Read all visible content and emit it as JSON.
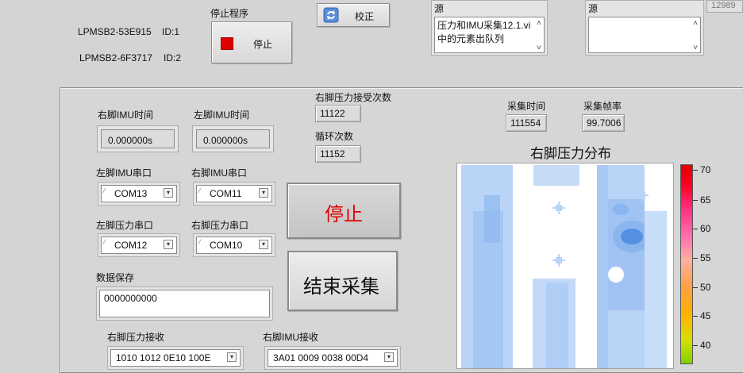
{
  "top": {
    "device1_name": "LPMSB2-53E915",
    "device1_id": "ID:1",
    "device2_name": "LPMSB2-6F3717",
    "device2_id": "ID:2",
    "stop_program_label": "停止程序",
    "stop_button": "停止",
    "calibrate_button": "校正",
    "source1_label": "源",
    "source1_text": "压力和IMU采集12.1.vi中的元素出队列",
    "source2_label": "源",
    "source2_text": "",
    "corner_value": "12989"
  },
  "panel": {
    "right_imu_time_label": "右脚IMU时间",
    "right_imu_time": "0.000000s",
    "left_imu_time_label": "左脚IMU时间",
    "left_imu_time": "0.000000s",
    "right_pressure_count_label": "右脚压力接受次数",
    "right_pressure_count": "11122",
    "loop_count_label": "循环次数",
    "loop_count": "11152",
    "collect_time_label": "采集时间",
    "collect_time": "111554",
    "collect_fps_label": "采集帧率",
    "collect_fps": "99.7006",
    "left_imu_port_label": "左脚IMU串口",
    "left_imu_port": "COM13",
    "right_imu_port_label": "右脚IMU串口",
    "right_imu_port": "COM11",
    "left_pressure_port_label": "左脚压力串口",
    "left_pressure_port": "COM12",
    "right_pressure_port_label": "右脚压力串口",
    "right_pressure_port": "COM10",
    "stop_big_button": "停止",
    "end_collect_button": "结束采集",
    "data_save_label": "数据保存",
    "data_save_value": "0000000000",
    "right_pressure_recv_label": "右脚压力接收",
    "right_pressure_recv": "1010 1012 0E10 100E",
    "right_imu_recv_label": "右脚IMU接收",
    "right_imu_recv": "3A01 0009 0038 00D4",
    "heatmap_title": "右脚压力分布",
    "colorbar_ticks": [
      "70",
      "65",
      "60",
      "55",
      "50",
      "45",
      "40"
    ]
  },
  "colors": {
    "stop_red": "#e00000",
    "heat_light": "#b9d4f7",
    "heat_mid": "#7fb0ef",
    "heat_dark": "#3d7fdc"
  }
}
